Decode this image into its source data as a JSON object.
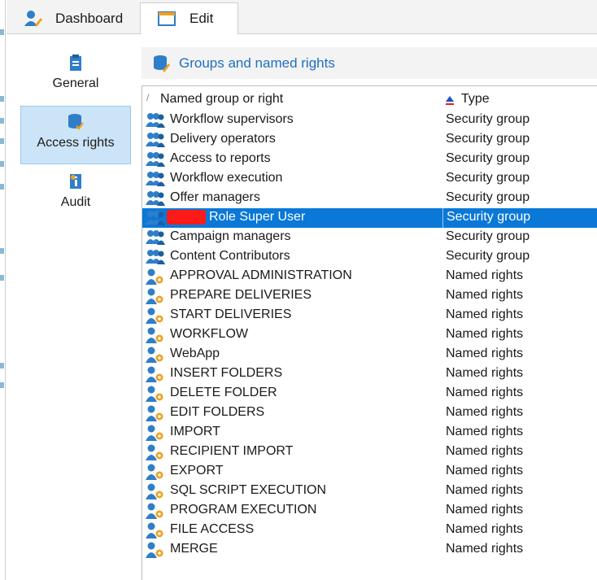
{
  "tabs": [
    {
      "label": "Dashboard",
      "icon": "user-edit-icon"
    },
    {
      "label": "Edit",
      "icon": "window-icon"
    }
  ],
  "sidebar": {
    "items": [
      {
        "label": "General",
        "icon": "clipboard-icon"
      },
      {
        "label": "Access rights",
        "icon": "database-check-icon",
        "active": true
      },
      {
        "label": "Audit",
        "icon": "info-doc-icon"
      }
    ]
  },
  "section": {
    "title": "Groups and named rights",
    "icon": "database-edit-icon"
  },
  "list": {
    "columns": {
      "name": "Named group or right",
      "type": "Type"
    },
    "rows": [
      {
        "name": "Workflow supervisors",
        "type": "Security group",
        "kind": "group"
      },
      {
        "name": "Delivery operators",
        "type": "Security group",
        "kind": "group"
      },
      {
        "name": "Access to reports",
        "type": "Security group",
        "kind": "group"
      },
      {
        "name": "Workflow execution",
        "type": "Security group",
        "kind": "group"
      },
      {
        "name": "Offer managers",
        "type": "Security group",
        "kind": "group"
      },
      {
        "name": "Role Super User",
        "type": "Security group",
        "kind": "group",
        "selected": true,
        "redacted_prefix": true
      },
      {
        "name": "Campaign managers",
        "type": "Security group",
        "kind": "group"
      },
      {
        "name": "Content Contributors",
        "type": "Security group",
        "kind": "group"
      },
      {
        "name": "APPROVAL ADMINISTRATION",
        "type": "Named rights",
        "kind": "right"
      },
      {
        "name": "PREPARE DELIVERIES",
        "type": "Named rights",
        "kind": "right"
      },
      {
        "name": "START DELIVERIES",
        "type": "Named rights",
        "kind": "right"
      },
      {
        "name": "WORKFLOW",
        "type": "Named rights",
        "kind": "right"
      },
      {
        "name": "WebApp",
        "type": "Named rights",
        "kind": "right"
      },
      {
        "name": "INSERT FOLDERS",
        "type": "Named rights",
        "kind": "right"
      },
      {
        "name": "DELETE FOLDER",
        "type": "Named rights",
        "kind": "right"
      },
      {
        "name": "EDIT FOLDERS",
        "type": "Named rights",
        "kind": "right"
      },
      {
        "name": "IMPORT",
        "type": "Named rights",
        "kind": "right"
      },
      {
        "name": "RECIPIENT IMPORT",
        "type": "Named rights",
        "kind": "right"
      },
      {
        "name": "EXPORT",
        "type": "Named rights",
        "kind": "right"
      },
      {
        "name": "SQL SCRIPT EXECUTION",
        "type": "Named rights",
        "kind": "right"
      },
      {
        "name": "PROGRAM EXECUTION",
        "type": "Named rights",
        "kind": "right"
      },
      {
        "name": "FILE ACCESS",
        "type": "Named rights",
        "kind": "right"
      },
      {
        "name": "MERGE",
        "type": "Named rights",
        "kind": "right"
      }
    ]
  },
  "colors": {
    "accent": "#0a78d7",
    "selection_bg": "#cce4f7",
    "header_text": "#1f6fc5",
    "icon_blue": "#2f7ec9",
    "icon_orange": "#f0a020"
  }
}
